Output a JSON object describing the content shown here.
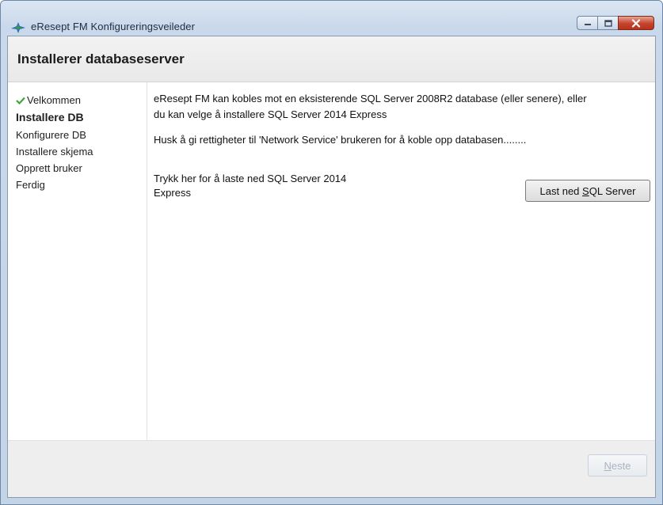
{
  "window": {
    "title": "eResept FM Konfigureringsveileder",
    "icons": {
      "app": "ereseptfm-app-icon",
      "minimize": "minimize-icon",
      "maximize": "maximize-icon",
      "close": "close-icon"
    }
  },
  "page": {
    "title": "Installerer databaseserver"
  },
  "steps": [
    {
      "label": "Velkommen",
      "state": "done",
      "icon": "checkmark-icon"
    },
    {
      "label": "Installere DB",
      "state": "current"
    },
    {
      "label": "Konfigurere DB",
      "state": "pending"
    },
    {
      "label": "Installere skjema",
      "state": "pending"
    },
    {
      "label": "Opprett bruker",
      "state": "pending"
    },
    {
      "label": "Ferdig",
      "state": "pending"
    }
  ],
  "content": {
    "intro_line1": "eResept FM kan kobles mot en eksisterende SQL Server 2008R2 database (eller senere), eller",
    "intro_line2": "du kan velge å installere SQL Server 2014 Express",
    "note": "Husk å gi rettigheter til 'Network Service' brukeren for å koble opp databasen........",
    "download_text_line1": "Trykk her for å laste ned SQL Server 2014",
    "download_text_line2": "Express",
    "download_button": {
      "before": "Last ned ",
      "accel": "S",
      "after": "QL Server"
    }
  },
  "footer": {
    "next_button": {
      "accel": "N",
      "after": "este",
      "enabled": false
    }
  },
  "colors": {
    "check": "#3fa43a",
    "close_button": "#c5432c",
    "disabled_text": "#a9b4c3"
  }
}
